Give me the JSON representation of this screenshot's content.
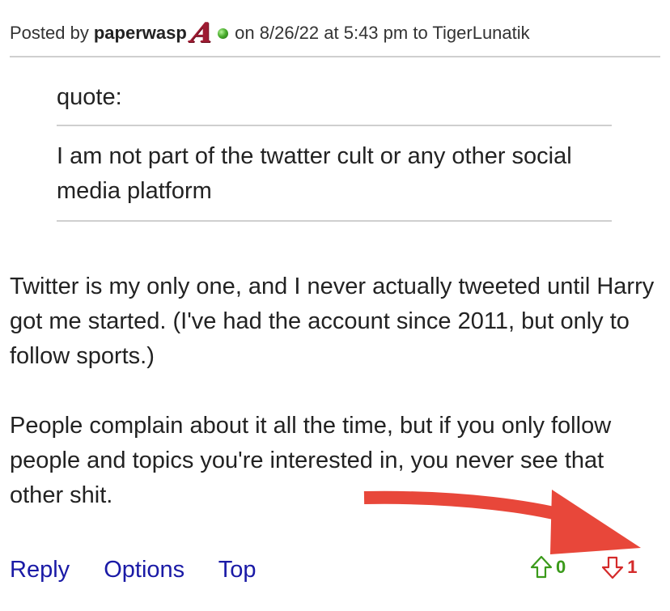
{
  "post": {
    "header": {
      "prefix": "Posted by",
      "author": "paperwasp",
      "team_logo": "A",
      "suffix": "on 8/26/22 at 5:43 pm to TigerLunatik"
    },
    "quote": {
      "label": "quote:",
      "text": "I am not part of the twatter cult or any other social media platform"
    },
    "body": [
      "Twitter is my only one, and I never actually tweeted until Harry got me started. (I've had the account since 2011, but only to follow sports.)",
      "People complain about it all the time, but if you only follow people and topics you're interested in, you never see that other shit."
    ],
    "footer": {
      "reply": "Reply",
      "options": "Options",
      "top": "Top"
    },
    "votes": {
      "up": "0",
      "down": "1"
    }
  },
  "colors": {
    "link": "#1a1aa6",
    "upvote": "#3a9a1a",
    "downvote": "#d42a2a",
    "annotation_arrow": "#e8473a",
    "team_logo": "#9e1b32"
  },
  "icons": {
    "online_status": "online-status-icon",
    "upvote": "thumb-up-arrow-icon",
    "downvote": "thumb-down-arrow-icon"
  }
}
